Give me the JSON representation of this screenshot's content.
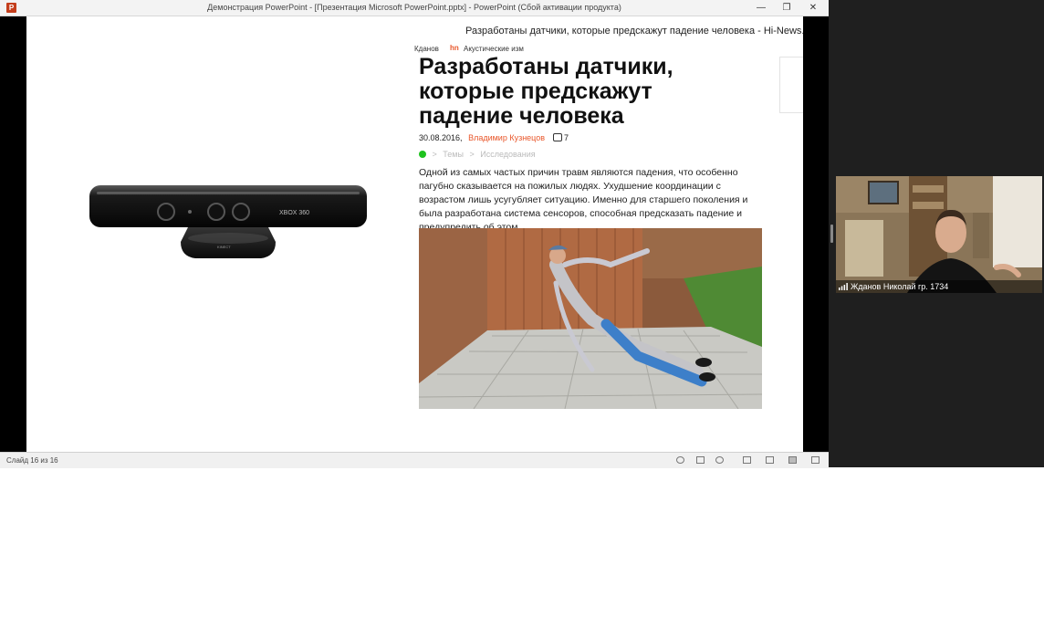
{
  "window": {
    "title": "Демонстрация PowerPoint - [Презентация Microsoft PowerPoint.pptx] - PowerPoint (Сбой активации продукта)",
    "logo_letter": "P",
    "minimize_glyph": "—",
    "restore_glyph": "❐",
    "close_glyph": "✕"
  },
  "slide": {
    "site_title": "Разработаны датчики, которые предскажут падение человека - Hi-News.ru",
    "crumb_user": "Кданов",
    "crumb_acoustic_icon": "hn",
    "crumb_acoustic": "Акустические изм",
    "headline": "Разработаны датчики, которые предскажут падение человека",
    "date": "30.08.2016,",
    "author": "Владимир Кузнецов",
    "comments": "7",
    "tags": [
      "Темы",
      "Исследования"
    ],
    "tag_separator": ">",
    "lead": "Одной из самых частых причин травм являются падения, что особенно пагубно сказывается на пожилых людях. Ухудшение координации с возрастом лишь усугубляет ситуацию. Именно для старшего поколения и была разработана система сенсоров, способная предсказать падение и предупредить об этом.",
    "kinect_brand": "XBOX 360",
    "kinect_label": "KINECT"
  },
  "statusbar": {
    "slide_counter": "Слайд 16 из 16"
  },
  "video": {
    "participant_name": "Жданов Николай гр. 1734"
  },
  "colors": {
    "accent": "#e9572b",
    "ppt_red": "#c43e1c"
  }
}
